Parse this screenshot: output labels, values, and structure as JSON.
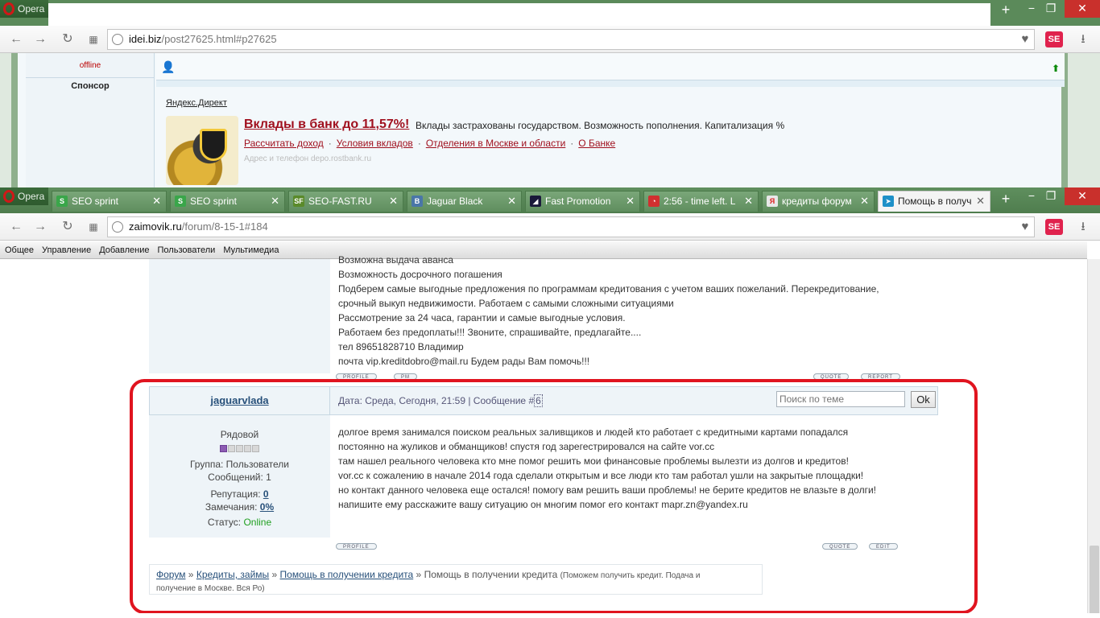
{
  "browser": {
    "opera_label": "Opera",
    "add_tab": "+",
    "minimize": "−",
    "maximize": "❐",
    "close": "✕"
  },
  "window1": {
    "url_host": "idei.biz",
    "url_path": "/post27625.html#p27625",
    "user_status": "offline",
    "sponsor_label": "Спонсор",
    "yandex_direct": "Яндекс.Директ",
    "ad_title": "Вклады в банк до 11,57%!",
    "ad_desc": "Вклады застрахованы государством. Возможность пополнения. Капитализация %",
    "ad_links": [
      "Рассчитать доход",
      "Условия вкладов",
      "Отделения в Москве и области",
      "О Банке"
    ],
    "ad_addr": "Адрес и телефон  depo.rostbank.ru"
  },
  "window2": {
    "tabs": [
      {
        "label": "SEO sprint",
        "icon": "seo-sprint-icon",
        "icon_char": "S",
        "icon_color": "#3aa64a"
      },
      {
        "label": "SEO sprint",
        "icon": "seo-sprint-icon",
        "icon_char": "S",
        "icon_color": "#3aa64a"
      },
      {
        "label": "SEO-FAST.RU",
        "icon": "seo-fast-icon",
        "icon_char": "SF",
        "icon_color": "#5a8a2a"
      },
      {
        "label": "Jaguar Black",
        "icon": "vk-icon",
        "icon_char": "B",
        "icon_color": "#4a76a8"
      },
      {
        "label": "Fast Promotion",
        "icon": "fast-promotion-icon",
        "icon_char": "◢",
        "icon_color": "#1a1a3a"
      },
      {
        "label": "2:56 - time left. L",
        "icon": "timer-icon",
        "icon_char": "◔",
        "icon_color": "#d03030"
      },
      {
        "label": "кредиты форум",
        "icon": "yandex-icon",
        "icon_char": "Я",
        "icon_color": "#e8e8e8"
      },
      {
        "label": "Помощь в получ",
        "icon": "bird-icon",
        "icon_char": "➤",
        "icon_color": "#1e90c8"
      }
    ],
    "url_host": "zaimovik.ru",
    "url_path": "/forum/8-15-1#184",
    "menu": [
      "Общее",
      "Управление",
      "Добавление",
      "Пользователи",
      "Мультимедиа"
    ]
  },
  "post1": {
    "lines": [
      "Возможна выдача аванса",
      "Возможность досрочного погашения",
      "Подберем самые выгодные предложения по программам кредитования с учетом ваших пожеланий. Перекредитование,",
      "срочный выкуп недвижимости. Работаем с самыми сложными ситуациями",
      "Рассмотрение за 24 часа, гарантии и самые выгодные условия.",
      "Работаем без предоплаты!!! Звоните, спрашивайте, предлагайте....",
      "тел 89651828710 Владимир",
      "почта vip.kreditdobro@mail.ru Будем рады Вам помочь!!!"
    ],
    "buttons": {
      "profile": "PROFILE",
      "pm": "PM",
      "quote": "QUOTE",
      "report": "REPORT"
    }
  },
  "post2": {
    "author": "jaguarvlada",
    "date_prefix": "Дата: Среда, Сегодня, 21:59 | Сообщение #",
    "msg_num": "6",
    "rank": "Рядовой",
    "stars_on": 1,
    "stars_total": 5,
    "group": "Группа: Пользователи",
    "posts": "Сообщений: 1",
    "rep_label": "Репутация: ",
    "rep_value": "0",
    "warn_label": "Замечания: ",
    "warn_value": "0%",
    "status_label": "Статус: ",
    "status_value": "Online",
    "lines": [
      "долгое время занимался поиском реальных заливщиков и людей кто работает с кредитными картами попадался",
      "постоянно на жуликов и обманщиков! спустя год зарегестрировался на сайте vor.cc",
      "там нашел реального человека кто мне помог решить мои финансовые проблемы вылезти из долгов и кредитов!",
      "vor.cc к сожалению в начале 2014 года сделали открытым и все люди кто там работал ушли на закрытые площадки!",
      "но контакт данного человека еще остался! помогу вам решить ваши проблемы! не берите кредитов не влазьте в долги!",
      "напишите ему расскажите вашу ситуацию он многим помог его контакт mapr.zn@yandex.ru"
    ],
    "buttons": {
      "profile": "PROFILE",
      "quote": "QUOTE",
      "edit": "EDIT"
    }
  },
  "breadcrumb": {
    "items": [
      "Форум",
      "Кредиты, займы",
      "Помощь в получении кредита"
    ],
    "current": "Помощь в получении кредита",
    "sep": "»",
    "desc_line1": "(Поможем получить кредит. Подача и",
    "desc_line2": "получение в Москве. Вся Ро)"
  },
  "search": {
    "placeholder": "Поиск по теме",
    "button": "Ok"
  },
  "colors": {
    "highlight": "#e0141f",
    "link": "#27507a",
    "ad_red": "#a0101e",
    "online": "#21a021"
  }
}
